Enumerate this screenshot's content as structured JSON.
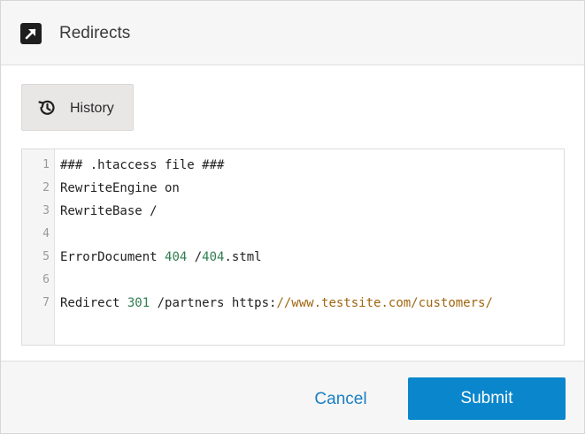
{
  "header": {
    "title": "Redirects",
    "icon": "external-link-arrow-icon"
  },
  "history_button": {
    "label": "History",
    "icon": "history-clock-icon"
  },
  "editor": {
    "line_numbers": [
      "1",
      "2",
      "3",
      "4",
      "5",
      "6",
      "7"
    ],
    "lines": [
      [
        {
          "text": "### .htaccess file ###",
          "kind": "plain"
        }
      ],
      [
        {
          "text": "RewriteEngine on",
          "kind": "plain"
        }
      ],
      [
        {
          "text": "RewriteBase /",
          "kind": "plain"
        }
      ],
      [],
      [
        {
          "text": "ErrorDocument ",
          "kind": "plain"
        },
        {
          "text": "404",
          "kind": "num"
        },
        {
          "text": " /",
          "kind": "plain"
        },
        {
          "text": "404",
          "kind": "num"
        },
        {
          "text": ".stml",
          "kind": "plain"
        }
      ],
      [],
      [
        {
          "text": "Redirect ",
          "kind": "plain"
        },
        {
          "text": "301",
          "kind": "num"
        },
        {
          "text": " /partners https:",
          "kind": "plain"
        },
        {
          "text": "//www.testsite.com/customers/",
          "kind": "url"
        }
      ]
    ]
  },
  "footer": {
    "cancel_label": "Cancel",
    "submit_label": "Submit"
  },
  "colors": {
    "accent": "#0a86cc",
    "link": "#1a7fc4",
    "number_token": "#2e7d4f",
    "url_token": "#a0650f"
  }
}
